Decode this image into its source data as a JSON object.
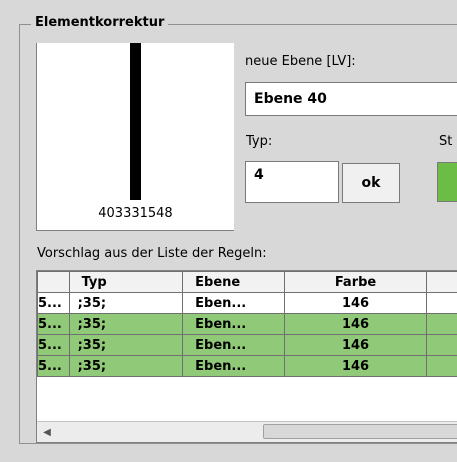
{
  "group": {
    "title": "Elementkorrektur"
  },
  "preview": {
    "caption": "403331548"
  },
  "layer": {
    "label": "neue Ebene [LV]:",
    "value": "Ebene 40"
  },
  "type": {
    "label": "Typ:",
    "value": "4",
    "ok_label": "ok"
  },
  "style": {
    "label_partial": "St",
    "color": "#6cbd45"
  },
  "suggestions": {
    "label": "Vorschlag aus der Liste der Regeln:",
    "columns": [
      "",
      "Typ",
      "Ebene",
      "Farbe"
    ],
    "rows": [
      {
        "c0": "5...",
        "typ": ";35;",
        "ebene": "Eben...",
        "farbe": "146",
        "selected": false
      },
      {
        "c0": "5...",
        "typ": ";35;",
        "ebene": "Eben...",
        "farbe": "146",
        "selected": true
      },
      {
        "c0": "5...",
        "typ": ";35;",
        "ebene": "Eben...",
        "farbe": "146",
        "selected": true
      },
      {
        "c0": "5...",
        "typ": ";35;",
        "ebene": "Eben...",
        "farbe": "146",
        "selected": true
      }
    ]
  },
  "colors": {
    "selected_row": "#90c978",
    "window_bg": "#d8d8d8"
  }
}
